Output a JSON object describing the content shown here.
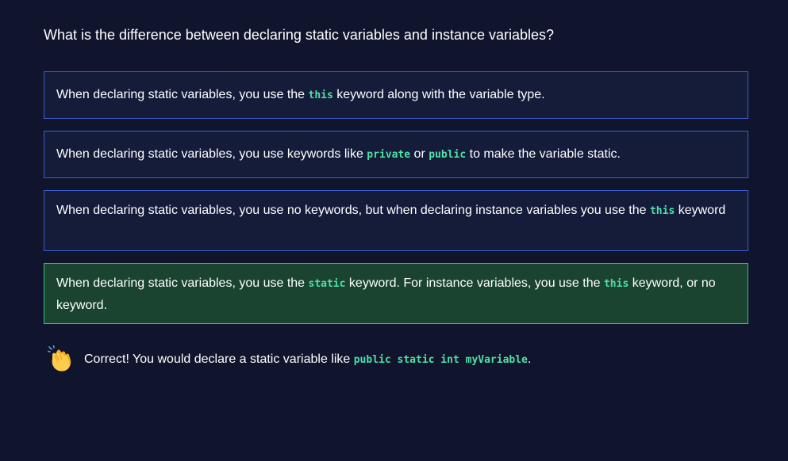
{
  "question": {
    "text": "What is the difference between declaring static variables and instance variables?"
  },
  "options": [
    {
      "parts": {
        "t1": "When declaring static variables, you use the ",
        "c1": "this",
        "t2": " keyword along with the variable type."
      },
      "selected": false
    },
    {
      "parts": {
        "t1": "When declaring static variables, you use keywords like ",
        "c1": "private",
        "t2": " or ",
        "c2": "public",
        "t3": " to make the variable static."
      },
      "selected": false
    },
    {
      "parts": {
        "t1": "When declaring static variables, you use no keywords, but when declaring instance variables you use the ",
        "c1": "this",
        "t2": " keyword"
      },
      "selected": false
    },
    {
      "parts": {
        "t1": "When declaring static variables, you use the ",
        "c1": "static",
        "t2": " keyword. For instance variables, you use the ",
        "c2": "this",
        "t3": " keyword, or no keyword."
      },
      "selected": true,
      "status": "correct"
    }
  ],
  "feedback": {
    "icon": "clapping-hands-icon",
    "text_before": "Correct! You would declare a static variable like ",
    "code": "public static int myVariable",
    "text_after": "."
  },
  "colors": {
    "background": "#10152d",
    "option_bg": "#141c3a",
    "option_border": "#3a5ccc",
    "correct_bg": "#1a4430",
    "correct_border": "#3bbd7a",
    "code": "#4fe0a6"
  }
}
